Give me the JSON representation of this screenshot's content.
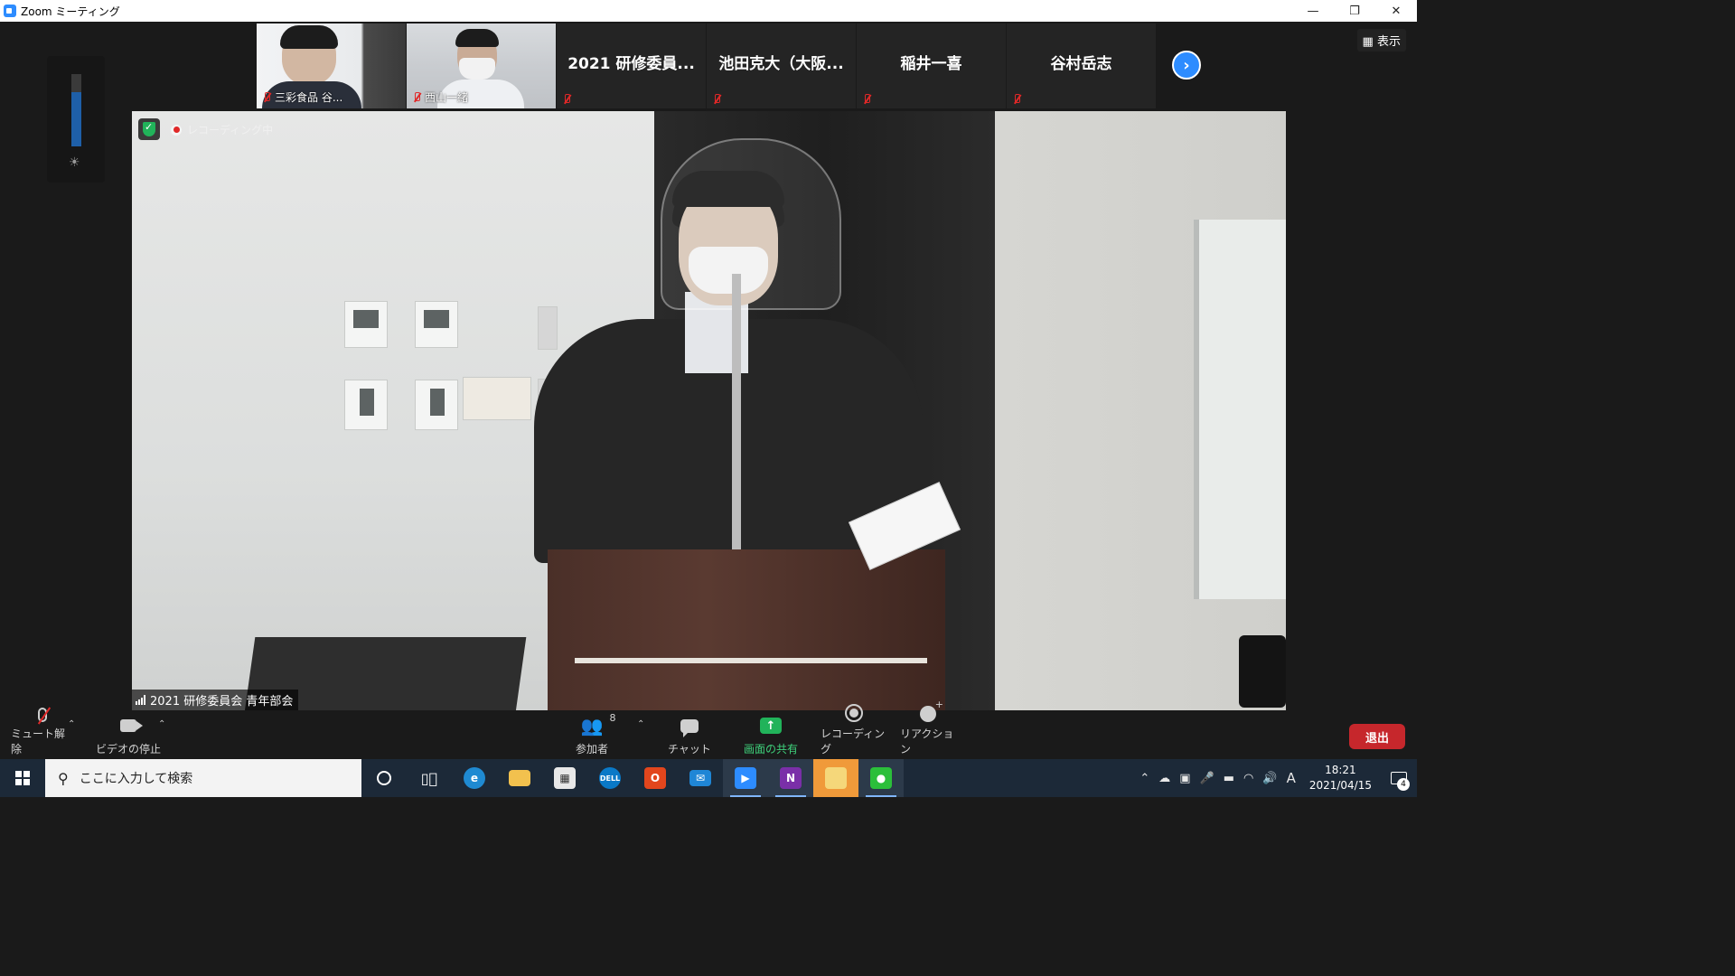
{
  "window": {
    "title": "Zoom ミーティング",
    "minimize": "—",
    "restore": "❐",
    "close": "✕"
  },
  "gallery": {
    "participants": [
      {
        "name": "三彩食品 谷...",
        "has_video": true,
        "muted": true
      },
      {
        "name": "西山一緒",
        "has_video": true,
        "muted": true
      },
      {
        "name": "2021 研修委員...",
        "has_video": false,
        "muted": true
      },
      {
        "name": "池田克大（大阪...",
        "has_video": false,
        "muted": true
      },
      {
        "name": "稲井一喜",
        "has_video": false,
        "muted": true
      },
      {
        "name": "谷村岳志",
        "has_video": false,
        "muted": true
      }
    ],
    "next_icon": "chevron-right-icon",
    "view_label": "表示"
  },
  "main_video": {
    "recording_label": "レコーディング中",
    "speaker_name": "2021 研修委員会 青年部会"
  },
  "toolbar": {
    "unmute_label": "ミュート解除",
    "stop_video_label": "ビデオの停止",
    "participants_label": "参加者",
    "participants_count": "8",
    "chat_label": "チャット",
    "share_label": "画面の共有",
    "record_label": "レコーディング",
    "reaction_label": "リアクション",
    "leave_label": "退出",
    "share_color": "#3ed17b",
    "leave_color": "#c6272c"
  },
  "taskbar": {
    "search_placeholder": "ここに入力して検索",
    "time": "18:21",
    "date": "2021/04/15",
    "notification_count": "4",
    "ime_label": "A"
  }
}
